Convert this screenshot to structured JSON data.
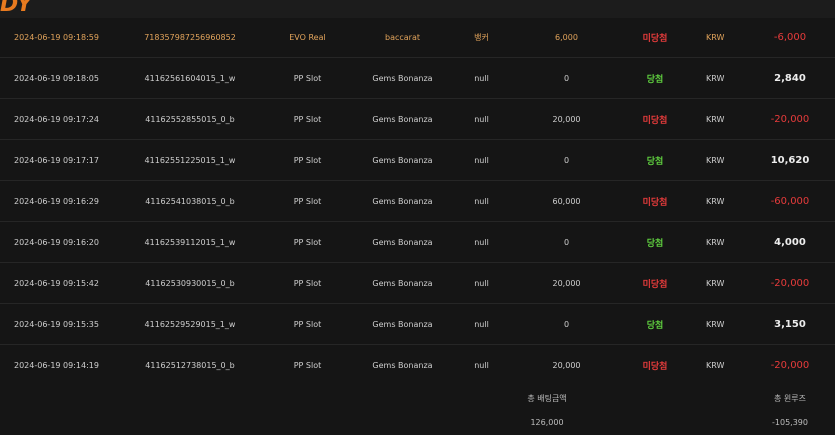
{
  "logo": {
    "text": "DY"
  },
  "rows": [
    {
      "date": "2024-06-19 09:18:59",
      "bet_id": "718357987256960852",
      "provider": "EVO Real",
      "game": "baccarat",
      "choice": "뱅커",
      "bet": "6,000",
      "result": "미당첨",
      "result_type": "loss",
      "currency": "KRW",
      "payout": "-6,000"
    },
    {
      "date": "2024-06-19 09:18:05",
      "bet_id": "41162561604015_1_w",
      "provider": "PP Slot",
      "game": "Gems Bonanza",
      "choice": "null",
      "bet": "0",
      "result": "당첨",
      "result_type": "win",
      "currency": "KRW",
      "payout": "2,840"
    },
    {
      "date": "2024-06-19 09:17:24",
      "bet_id": "41162552855015_0_b",
      "provider": "PP Slot",
      "game": "Gems Bonanza",
      "choice": "null",
      "bet": "20,000",
      "result": "미당첨",
      "result_type": "loss",
      "currency": "KRW",
      "payout": "-20,000"
    },
    {
      "date": "2024-06-19 09:17:17",
      "bet_id": "41162551225015_1_w",
      "provider": "PP Slot",
      "game": "Gems Bonanza",
      "choice": "null",
      "bet": "0",
      "result": "당첨",
      "result_type": "win",
      "currency": "KRW",
      "payout": "10,620"
    },
    {
      "date": "2024-06-19 09:16:29",
      "bet_id": "41162541038015_0_b",
      "provider": "PP Slot",
      "game": "Gems Bonanza",
      "choice": "null",
      "bet": "60,000",
      "result": "미당첨",
      "result_type": "loss",
      "currency": "KRW",
      "payout": "-60,000"
    },
    {
      "date": "2024-06-19 09:16:20",
      "bet_id": "41162539112015_1_w",
      "provider": "PP Slot",
      "game": "Gems Bonanza",
      "choice": "null",
      "bet": "0",
      "result": "당첨",
      "result_type": "win",
      "currency": "KRW",
      "payout": "4,000"
    },
    {
      "date": "2024-06-19 09:15:42",
      "bet_id": "41162530930015_0_b",
      "provider": "PP Slot",
      "game": "Gems Bonanza",
      "choice": "null",
      "bet": "20,000",
      "result": "미당첨",
      "result_type": "loss",
      "currency": "KRW",
      "payout": "-20,000"
    },
    {
      "date": "2024-06-19 09:15:35",
      "bet_id": "41162529529015_1_w",
      "provider": "PP Slot",
      "game": "Gems Bonanza",
      "choice": "null",
      "bet": "0",
      "result": "당첨",
      "result_type": "win",
      "currency": "KRW",
      "payout": "3,150"
    },
    {
      "date": "2024-06-19 09:14:19",
      "bet_id": "41162512738015_0_b",
      "provider": "PP Slot",
      "game": "Gems Bonanza",
      "choice": "null",
      "bet": "20,000",
      "result": "미당첨",
      "result_type": "loss",
      "currency": "KRW",
      "payout": "-20,000"
    }
  ],
  "summary": {
    "total_bet_label": "총 배팅금액",
    "total_bet_value": "126,000",
    "total_winloss_label": "총 윈루즈",
    "total_winloss_value": "-105,390"
  },
  "colors": {
    "accent": "#e87a1f",
    "win": "#5fcf3f",
    "loss": "#e63b3b",
    "first_row_text": "#e1a35b"
  }
}
